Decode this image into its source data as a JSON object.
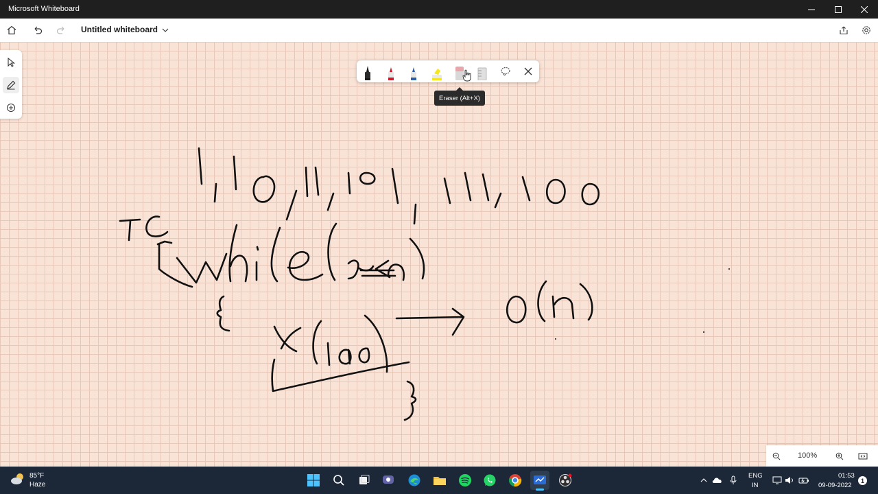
{
  "window": {
    "title": "Microsoft Whiteboard",
    "controls": [
      "minimize",
      "maximize",
      "close"
    ]
  },
  "toolbar": {
    "document_title": "Untitled whiteboard",
    "icons": [
      "home-icon",
      "undo-icon",
      "redo-icon",
      "share-icon",
      "settings-icon"
    ]
  },
  "left_rail": {
    "tools": [
      "select",
      "inking",
      "add"
    ]
  },
  "ink_toolbar": {
    "tools": [
      {
        "name": "black-pen",
        "color": "#1a1a1a"
      },
      {
        "name": "red-pen",
        "color": "#d01c2a"
      },
      {
        "name": "blue-pen",
        "color": "#2d5fa6"
      },
      {
        "name": "highlighter",
        "color": "#f5e61e"
      },
      {
        "name": "eraser",
        "color": "#e8a5aa"
      },
      {
        "name": "ruler",
        "color": "#b8b8b8"
      },
      {
        "name": "lasso",
        "color": "#555555"
      },
      {
        "name": "close",
        "color": "#333333"
      }
    ],
    "tooltip": "Eraser (Alt+X)"
  },
  "zoom": {
    "level": "100%"
  },
  "taskbar": {
    "weather_temp": "85°F",
    "weather_desc": "Haze",
    "apps": [
      "windows-start",
      "search",
      "task-view",
      "teams-chat",
      "edge",
      "file-explorer",
      "spotify",
      "whatsapp",
      "chrome",
      "whiteboard",
      "obs"
    ],
    "lang_line1": "ENG",
    "lang_line2": "IN",
    "time": "01:53",
    "date": "09-09-2022",
    "notifications": "1"
  },
  "colors": {
    "canvas_bg": "#f9e3d6",
    "grid_line": "#e7c8b8",
    "titlebar_bg": "#1f1f1f",
    "taskbar_bg": "#1c2838"
  }
}
